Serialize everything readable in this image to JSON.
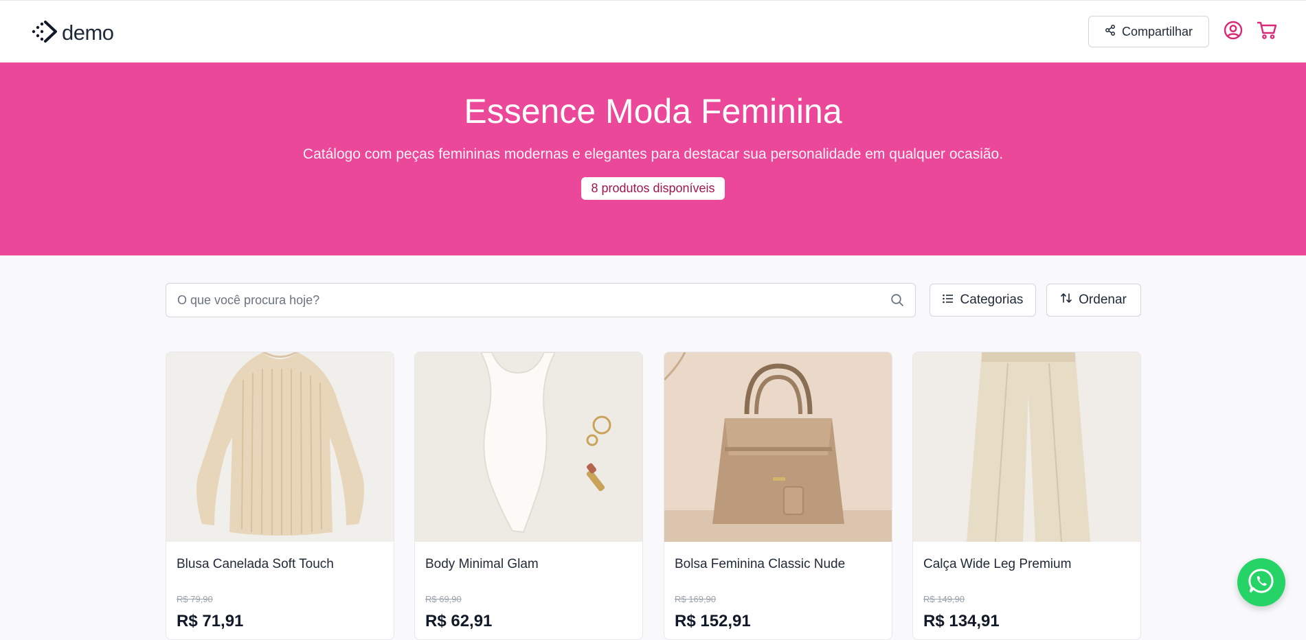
{
  "header": {
    "logo_text": "demo",
    "share_label": "Compartilhar",
    "icons": {
      "share": "share-icon",
      "account": "user-circle-icon",
      "cart": "cart-icon"
    }
  },
  "hero": {
    "title": "Essence Moda Feminina",
    "description": "Catálogo com peças femininas modernas e elegantes para destacar sua personalidade em qualquer ocasião.",
    "badge": "8 produtos disponíveis"
  },
  "toolbar": {
    "search_placeholder": "O que você procura hoje?",
    "categories_label": "Categorias",
    "sort_label": "Ordenar"
  },
  "products": [
    {
      "name": "Blusa Canelada Soft Touch",
      "old_price": "R$ 79,90",
      "price": "R$ 71,91",
      "image": "ribbed-sweater"
    },
    {
      "name": "Body Minimal Glam",
      "old_price": "R$ 69,90",
      "price": "R$ 62,91",
      "image": "white-bodysuit"
    },
    {
      "name": "Bolsa Feminina Classic Nude",
      "old_price": "R$ 169,90",
      "price": "R$ 152,91",
      "image": "nude-handbag"
    },
    {
      "name": "Calça Wide Leg Premium",
      "old_price": "R$ 149,90",
      "price": "R$ 134,91",
      "image": "wide-leg-pants"
    }
  ],
  "colors": {
    "brand": "#ec4899",
    "accent_icon": "#db2777",
    "badge_text": "#9d174d",
    "whatsapp": "#25d366"
  },
  "whatsapp_icon": "whatsapp-icon"
}
